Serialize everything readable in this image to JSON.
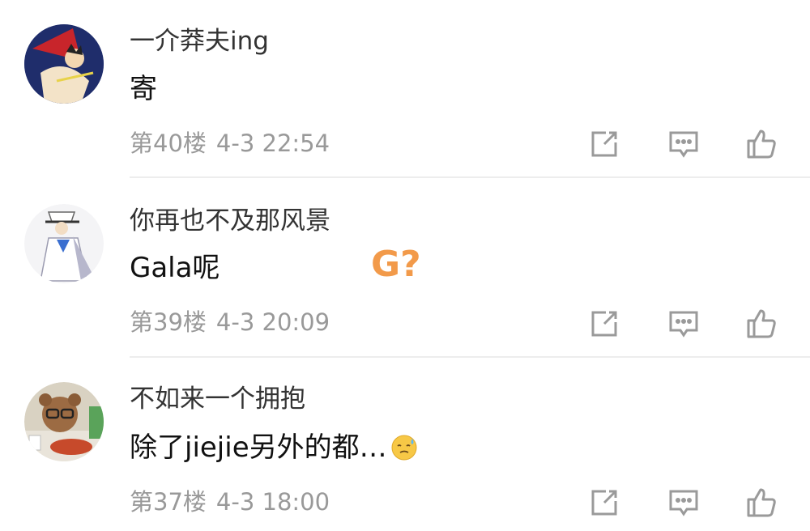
{
  "comments": [
    {
      "username": "一介莽夫ing",
      "text": "寄",
      "floor": "第40楼",
      "time": "4-3 22:54"
    },
    {
      "username": "你再也不及那风景",
      "text": "Gala呢",
      "floor": "第39楼",
      "time": "4-3 20:09"
    },
    {
      "username": "不如来一个拥抱",
      "text": "除了jiejie另外的都…",
      "floor": "第37楼",
      "time": "4-3 18:00"
    }
  ],
  "overlay": {
    "text": "G?",
    "color": "#f29a4a"
  },
  "icons": {
    "share": "share-icon",
    "reply": "reply-icon",
    "like": "like-icon",
    "emoji": "sweat-smile-emoji"
  },
  "colors": {
    "username": "#333333",
    "content": "#111111",
    "meta": "#999999",
    "icon": "#9a9a9a",
    "divider": "#ededed"
  }
}
